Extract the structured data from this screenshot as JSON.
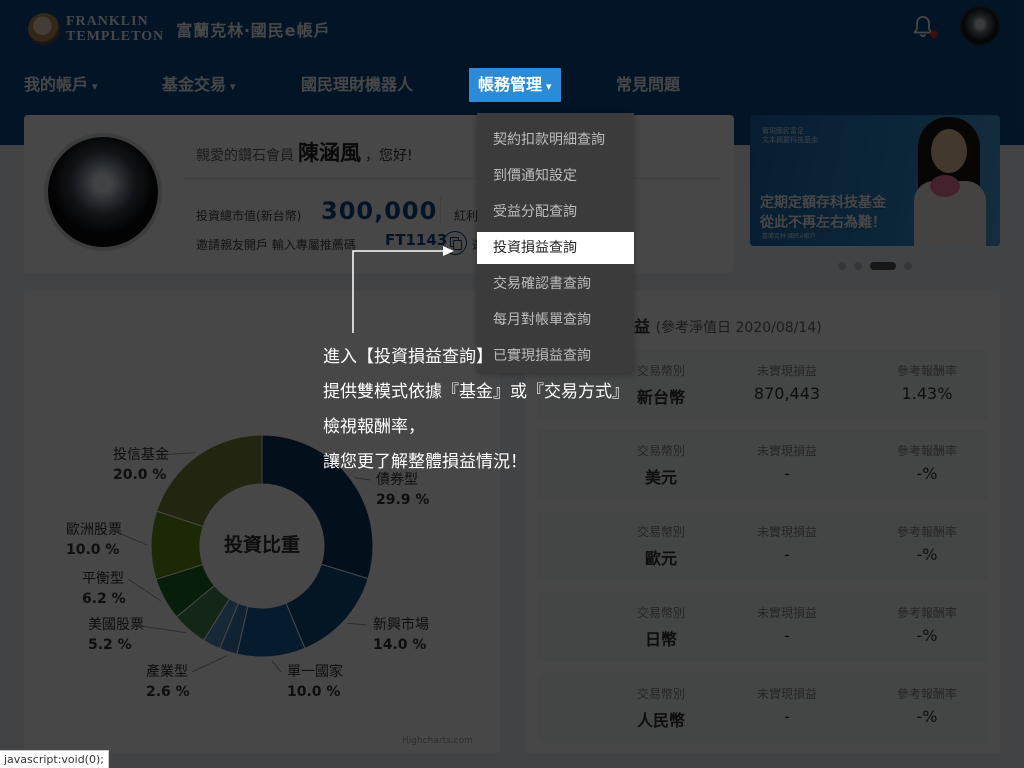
{
  "header": {
    "logo_text_line1": "FRANKLIN",
    "logo_text_line2": "TEMPLETON",
    "app_title": "富蘭克林‧國民e帳戶",
    "bell_icon": "bell-icon",
    "notification_color": "#e0302b"
  },
  "nav": {
    "items": [
      {
        "label": "我的帳戶",
        "chevron": "▾"
      },
      {
        "label": "基金交易",
        "chevron": "▾"
      },
      {
        "label": "國民理財機器人"
      },
      {
        "label": "帳務管理",
        "chevron": "▾",
        "active": true
      },
      {
        "label": "常見問題"
      }
    ]
  },
  "dropdown": {
    "items": [
      {
        "label": "契約扣款明細查詢"
      },
      {
        "label": "到價通知設定"
      },
      {
        "label": "受益分配查詢"
      },
      {
        "label": "投資損益查詢",
        "highlighted": true
      },
      {
        "label": "交易確認書查詢"
      },
      {
        "label": "每月對帳單查詢"
      },
      {
        "label": "已實現損益查詢"
      }
    ]
  },
  "profile": {
    "greeting_prefix": "親愛的鑽石會員",
    "name": "陳涵風",
    "greeting_suffix": "，您好!",
    "market_value_label": "投資總市值(新台幣)",
    "market_value": "300,000",
    "dividend_label": "紅利",
    "invite_label": "邀請親友開戶 輸入專屬推薦碼",
    "referral_code": "FT1143",
    "after_copy": "邀"
  },
  "banner": {
    "small_text": "實現國民富足\n文本摘要科技基金",
    "headline": "定期定額存科技基金\n從此不再左右為難！",
    "footer": "富蘭克林‧國民e帳戶",
    "carousel_active_index": 2
  },
  "chart_data": {
    "type": "pie",
    "title": "投資比重",
    "segments": [
      {
        "name": "債券型",
        "value": 29.9,
        "label": "29.9 %",
        "color": "#0b3a66"
      },
      {
        "name": "新興市場",
        "value": 14.0,
        "label": "14.0 %",
        "color": "#0f4c80"
      },
      {
        "name": "單一國家",
        "value": 10.0,
        "label": "10.0 %",
        "color": "#1866a7"
      },
      {
        "name": "產業型",
        "value": 2.6,
        "label": "2.6 %",
        "color": "#3e7fb8"
      },
      {
        "name": "(未標示)",
        "value": 2.6,
        "label": "",
        "color": "#5b8fc0"
      },
      {
        "name": "美國股票",
        "value": 5.2,
        "label": "5.2 %",
        "color": "#4a8a57"
      },
      {
        "name": "平衡型",
        "value": 6.2,
        "label": "6.2 %",
        "color": "#1f6b2a"
      },
      {
        "name": "歐洲股票",
        "value": 10.0,
        "label": "10.0 %",
        "color": "#6a8f1c"
      },
      {
        "name": "投信基金",
        "value": 20.0,
        "label": "20.0 %",
        "color": "#7c8a3c"
      }
    ],
    "credit": "Highcharts.com"
  },
  "pnl": {
    "title": "投資損益",
    "title_visible": "益",
    "ref_date": "(參考淨值日 2020/08/14)",
    "col_currency": "交易幣別",
    "col_unrealized": "未實現損益",
    "col_return": "參考報酬率",
    "rows": [
      {
        "currency": "新台幣",
        "unrealized": "870,443",
        "return": "1.43%"
      },
      {
        "currency": "美元",
        "unrealized": "-",
        "return": "-%"
      },
      {
        "currency": "歐元",
        "unrealized": "-",
        "return": "-%"
      },
      {
        "currency": "日幣",
        "unrealized": "-",
        "return": "-%"
      },
      {
        "currency": "人民幣",
        "unrealized": "-",
        "return": "-%"
      }
    ]
  },
  "tooltip": {
    "line1": "進入【投資損益查詢】",
    "line2": "提供雙模式依據『基金』或『交易方式』",
    "line3": "檢視報酬率，",
    "line4": "讓您更了解整體損益情況！"
  },
  "status_bar": "javascript:void(0);"
}
